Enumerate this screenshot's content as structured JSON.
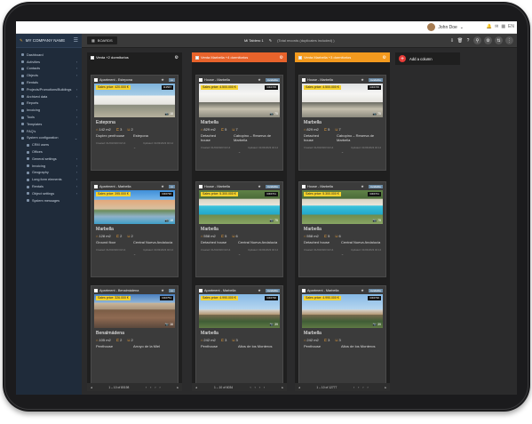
{
  "topbar": {
    "user_name": "John Doe",
    "language": "EN"
  },
  "sidebar": {
    "brand": "MY COMPANY NAME",
    "items": [
      {
        "label": "Dashboard",
        "level": 0
      },
      {
        "label": "Activities",
        "level": 0,
        "caret": "›"
      },
      {
        "label": "Contacts",
        "level": 0,
        "caret": "›"
      },
      {
        "label": "Objects",
        "level": 0,
        "caret": "›"
      },
      {
        "label": "Rentals",
        "level": 0
      },
      {
        "label": "Projects/Promotions/Buildings",
        "level": 0,
        "caret": "›"
      },
      {
        "label": "Archived data",
        "level": 0,
        "caret": "›"
      },
      {
        "label": "Reports",
        "level": 0
      },
      {
        "label": "Invoicing",
        "level": 0,
        "caret": "›"
      },
      {
        "label": "Tools",
        "level": 0,
        "caret": "›"
      },
      {
        "label": "Templates",
        "level": 0,
        "caret": "›"
      },
      {
        "label": "FAQ's",
        "level": 0
      },
      {
        "label": "System configuration",
        "level": 0,
        "caret": "⌄"
      },
      {
        "label": "CRM users",
        "level": 1
      },
      {
        "label": "Offices",
        "level": 1
      },
      {
        "label": "General settings",
        "level": 1,
        "caret": "›"
      },
      {
        "label": "Invoicing",
        "level": 1,
        "caret": "›"
      },
      {
        "label": "Geography",
        "level": 1,
        "caret": "›"
      },
      {
        "label": "Long form elements",
        "level": 1,
        "caret": "›"
      },
      {
        "label": "Rentals",
        "level": 1,
        "caret": "›"
      },
      {
        "label": "Object settings",
        "level": 1,
        "caret": "›"
      },
      {
        "label": "System messages",
        "level": 1
      }
    ]
  },
  "toolbar": {
    "boards_label": "BOARDS",
    "board_title": "Mi Tablero 1",
    "board_meta": "(Total records (duplicates included) )"
  },
  "add_column_label": "Add a column",
  "columns": [
    {
      "title": "Venta +2 dormitorios",
      "header_color": "#1f1f1f",
      "pager": "1 – 10 of 80198",
      "cards": [
        {
          "type": "Apartment - Estepona",
          "badge": "",
          "price": "Sales price: 420.000 €",
          "ref": "R4567",
          "photo": "villa",
          "photo_count": "18",
          "location": "Estepona",
          "size": "142 m2",
          "beds": "3",
          "baths": "2",
          "type1": "Duplex penthouse",
          "type2": "Estepona",
          "created": "Created: 01/03/2023 02:14",
          "updated": "Updated: 01/03/2023 02:14"
        },
        {
          "type": "Apartment - Marbella",
          "badge": "",
          "price": "Sales price: 395.000 €",
          "ref": "R46730",
          "photo": "apt",
          "photo_count": "18",
          "location": "Marbella",
          "size": "128 m2",
          "beds": "2",
          "baths": "2",
          "type1": "Ground floor",
          "type2": "Central Nueva Andalucía",
          "created": "Created: 01/03/2023 02:14",
          "updated": "Updated: 01/03/2023 02:14"
        },
        {
          "type": "Apartment - Benalmádena",
          "badge": "",
          "price": "Sales price: 326.000 €",
          "ref": "R46751",
          "photo": "roof",
          "photo_count": "16",
          "location": "Benalmádena",
          "size": "105 m2",
          "beds": "2",
          "baths": "2",
          "type1": "Penthouse",
          "type2": "Arroyo de la Miel",
          "created": "",
          "updated": ""
        }
      ]
    },
    {
      "title": "Venta Marbella +4 dormitorios",
      "header_color": "#e8632b",
      "pager": "1 – 10 of 6034",
      "cards": [
        {
          "type": "House - Marbella",
          "badge": "Available",
          "price": "Sales price: 4.500.000 €",
          "ref": "R46745",
          "photo": "white",
          "photo_count": "75",
          "location": "Marbella",
          "size": "829 m2",
          "beds": "5",
          "baths": "7",
          "type1": "Detached house",
          "type2": "Cabopino – Reserva de Marbella",
          "created": "Created: 01/03/2023 02:14",
          "updated": "Updated: 01/03/2023 02:14"
        },
        {
          "type": "House - Marbella",
          "badge": "Available",
          "price": "Sales price: 5.300.000 €",
          "ref": "R46741",
          "photo": "pool",
          "photo_count": "75",
          "location": "Marbella",
          "size": "558 m2",
          "beds": "5",
          "baths": "6",
          "type1": "Detached house",
          "type2": "Central Nueva Andalucía",
          "created": "Created: 01/03/2023 02:14",
          "updated": "Updated: 01/03/2023 02:14"
        },
        {
          "type": "Apartment - Marbella",
          "badge": "Available",
          "price": "Sales price: 4.990.000 €",
          "ref": "R46730",
          "photo": "terrace",
          "photo_count": "39",
          "location": "Marbella",
          "size": "242 m2",
          "beds": "3",
          "baths": "3",
          "type1": "Penthouse",
          "type2": "Altos de los Monteros",
          "created": "",
          "updated": ""
        }
      ]
    },
    {
      "title": "Venta Marbella +3 dormitorios",
      "header_color": "#f39a1e",
      "pager": "1 – 10 of 12777",
      "cards": [
        {
          "type": "House - Marbella",
          "badge": "Available",
          "price": "Sales price: 4.500.000 €",
          "ref": "R46745",
          "photo": "white",
          "photo_count": "75",
          "location": "Marbella",
          "size": "829 m2",
          "beds": "5",
          "baths": "7",
          "type1": "Detached house",
          "type2": "Cabopino – Reserva de Marbella",
          "created": "Created: 01/03/2023 02:14",
          "updated": "Updated: 01/03/2023 02:14"
        },
        {
          "type": "House - Marbella",
          "badge": "Available",
          "price": "Sales price: 5.300.000 €",
          "ref": "R46741",
          "photo": "pool",
          "photo_count": "75",
          "location": "Marbella",
          "size": "558 m2",
          "beds": "5",
          "baths": "6",
          "type1": "Detached house",
          "type2": "Central Nueva Andalucía",
          "created": "Created: 01/03/2023 02:14",
          "updated": "Updated: 01/03/2023 02:14"
        },
        {
          "type": "Apartment - Marbella",
          "badge": "Available",
          "price": "Sales price: 4.990.000 €",
          "ref": "R46730",
          "photo": "terrace",
          "photo_count": "39",
          "location": "Marbella",
          "size": "242 m2",
          "beds": "3",
          "baths": "3",
          "type1": "Penthouse",
          "type2": "Altos de los Monteros",
          "created": "",
          "updated": ""
        }
      ]
    }
  ]
}
